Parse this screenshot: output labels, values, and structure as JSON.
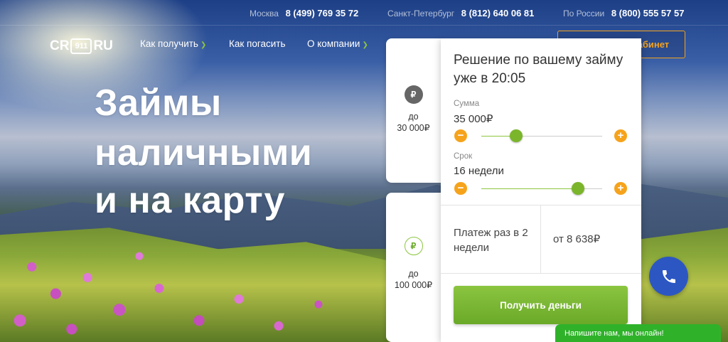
{
  "topbar": {
    "phones": [
      {
        "city": "Москва",
        "number": "8 (499) 769 35 72"
      },
      {
        "city": "Санкт-Петербург",
        "number": "8 (812) 640 06 81"
      },
      {
        "city": "По России",
        "number": "8 (800) 555 57 57"
      }
    ]
  },
  "nav": {
    "logo_left": "CR",
    "logo_mark": "911",
    "logo_right": "RU",
    "items": [
      {
        "label": "Как получить",
        "has_dropdown": true
      },
      {
        "label": "Как погасить",
        "has_dropdown": false
      },
      {
        "label": "О компании",
        "has_dropdown": true
      }
    ],
    "account_label": "Личный кабинет"
  },
  "hero": {
    "lines": [
      "Займы",
      "наличными",
      "и на карту"
    ]
  },
  "side_cards": [
    {
      "icon": "ruble-icon",
      "label_line1": "до",
      "label_line2": "30 000₽"
    },
    {
      "icon": "ruble-stack-icon",
      "label_line1": "до",
      "label_line2": "100 000₽"
    }
  ],
  "form": {
    "title": "Решение по вашему займу уже в 20:05",
    "amount_label": "Сумма",
    "amount_value": "35 000₽",
    "amount_fraction": 0.29,
    "term_label": "Срок",
    "term_value": "16 недели",
    "term_fraction": 0.8,
    "payment_label": "Платеж раз в 2 недели",
    "payment_value": "от 8 638₽",
    "submit_label": "Получить деньги"
  },
  "chat": {
    "label": "Напишите нам, мы онлайн!"
  },
  "colors": {
    "accent_orange": "#f6a31c",
    "accent_green": "#7bb52b",
    "call_blue": "#2c57c3",
    "chat_green": "#2fb22a"
  }
}
